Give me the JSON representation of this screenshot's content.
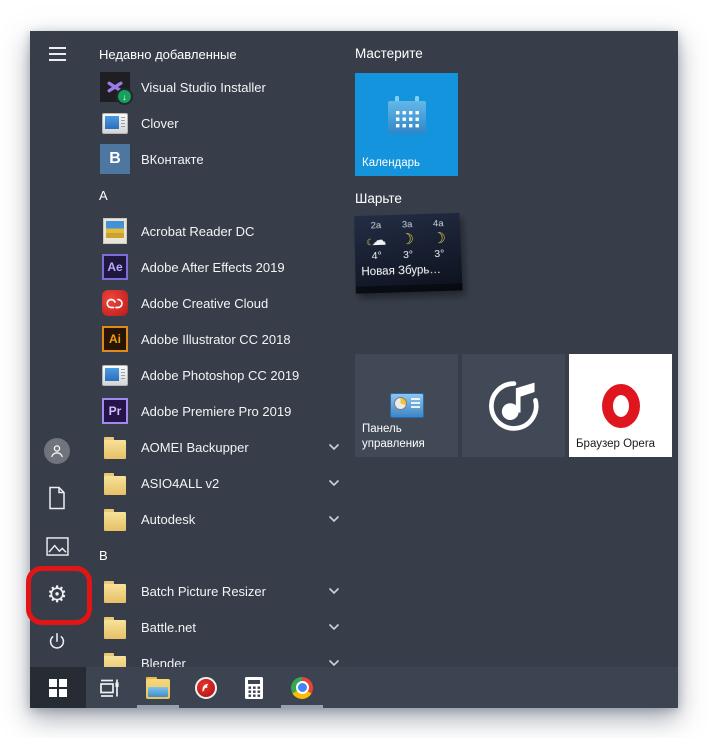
{
  "colors": {
    "panel_bg": "#373e4a",
    "taskbar_bg": "#3d4451",
    "start_button_bg": "#262b34",
    "tile_gray": "#414956",
    "calendar_tile_blue": "#1494dc",
    "highlight_red": "#e01515",
    "folder_yellow": "#f0d080",
    "active_underline": "#98a2af"
  },
  "nav_rail": {
    "items": [
      {
        "id": "menu-btn",
        "icon": "hamburger-icon"
      },
      {
        "id": "user",
        "icon": "user-icon"
      },
      {
        "id": "documents",
        "icon": "document-icon"
      },
      {
        "id": "pictures",
        "icon": "pictures-icon"
      },
      {
        "id": "settings",
        "icon": "gear-icon",
        "highlighted": true
      },
      {
        "id": "power",
        "icon": "power-icon"
      }
    ]
  },
  "app_list": {
    "sections": [
      {
        "header": "Недавно добавленные",
        "items": [
          {
            "label": "Visual Studio Installer",
            "icon": "visual-studio-installer-icon"
          },
          {
            "label": "Clover",
            "icon": "app-window-icon"
          },
          {
            "label": "ВКонтакте",
            "icon": "vk-icon"
          }
        ]
      },
      {
        "header": "А",
        "items": [
          {
            "label": "Acrobat Reader DC",
            "icon": "photo-icon"
          },
          {
            "label": "Adobe After Effects 2019",
            "icon": "after-effects-icon"
          },
          {
            "label": "Adobe Creative Cloud",
            "icon": "creative-cloud-icon"
          },
          {
            "label": "Adobe Illustrator CC 2018",
            "icon": "illustrator-icon"
          },
          {
            "label": "Adobe Photoshop CC 2019",
            "icon": "app-window-icon"
          },
          {
            "label": "Adobe Premiere Pro 2019",
            "icon": "premiere-icon"
          },
          {
            "label": "AOMEI Backupper",
            "icon": "folder-icon",
            "expandable": true
          },
          {
            "label": "ASIO4ALL v2",
            "icon": "folder-icon",
            "expandable": true
          },
          {
            "label": "Autodesk",
            "icon": "folder-icon",
            "expandable": true
          }
        ]
      },
      {
        "header": "B",
        "items": [
          {
            "label": "Batch Picture Resizer",
            "icon": "folder-icon",
            "expandable": true
          },
          {
            "label": "Battle.net",
            "icon": "folder-icon",
            "expandable": true
          },
          {
            "label": "Blender",
            "icon": "folder-icon",
            "expandable": true
          }
        ]
      }
    ]
  },
  "tile_groups": [
    {
      "header": "Мастерите",
      "tiles": [
        {
          "id": "calendar",
          "label": "Календарь",
          "icon": "calendar-icon",
          "style": "blue"
        }
      ]
    },
    {
      "header": "Шарьте",
      "tiles": [
        {
          "id": "weather",
          "label": "Новая Збурь…",
          "icon": "weather-icon",
          "style": "dark",
          "live": {
            "days": [
              "2а",
              "3а",
              "4а"
            ],
            "temps": [
              "4°",
              "3°",
              "3°"
            ],
            "icons": [
              "cloud-night-icon",
              "moon-icon",
              "moon-icon"
            ]
          }
        },
        {
          "id": "control-panel",
          "label": "Панель управления",
          "icon": "control-panel-icon",
          "style": "gray"
        },
        {
          "id": "music",
          "label": "",
          "icon": "music-note-icon",
          "style": "gray"
        },
        {
          "id": "opera",
          "label": "Браузер Opera",
          "icon": "opera-icon",
          "style": "white"
        }
      ]
    }
  ],
  "taskbar": {
    "items": [
      {
        "id": "start",
        "icon": "windows-logo-icon",
        "active": false
      },
      {
        "id": "task-view",
        "icon": "task-view-icon",
        "active": false
      },
      {
        "id": "file-explorer",
        "icon": "file-explorer-icon",
        "active": true
      },
      {
        "id": "red-app",
        "icon": "red-circle-app-icon",
        "active": false
      },
      {
        "id": "calculator",
        "icon": "calculator-icon",
        "active": false
      },
      {
        "id": "chrome",
        "icon": "chrome-icon",
        "active": true
      }
    ]
  }
}
